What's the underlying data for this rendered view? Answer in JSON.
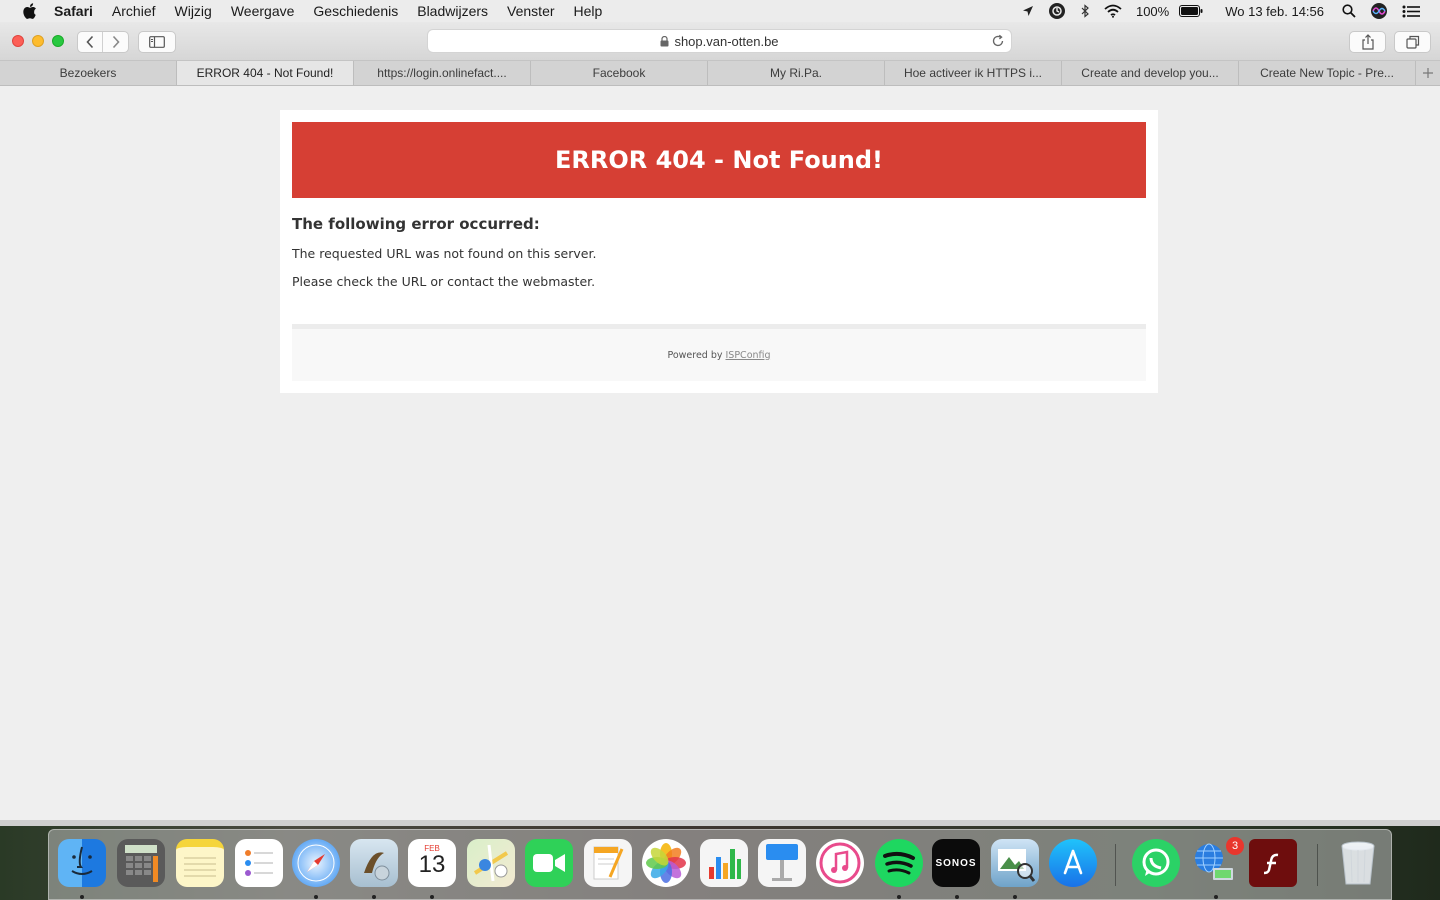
{
  "menubar": {
    "app_name": "Safari",
    "items": [
      "Archief",
      "Wijzig",
      "Weergave",
      "Geschiedenis",
      "Bladwijzers",
      "Venster",
      "Help"
    ],
    "battery": "100%",
    "clock": "Wo 13 feb.  14:56"
  },
  "toolbar": {
    "address": "shop.van-otten.be"
  },
  "tabs": [
    {
      "label": "Bezoekers"
    },
    {
      "label": "ERROR 404 - Not Found!"
    },
    {
      "label": "https://login.onlinefact...."
    },
    {
      "label": "Facebook"
    },
    {
      "label": "My Ri.Pa."
    },
    {
      "label": "Hoe activeer ik HTTPS i..."
    },
    {
      "label": "Create and develop you..."
    },
    {
      "label": "Create New Topic - Pre..."
    }
  ],
  "page": {
    "banner": "ERROR 404 - Not Found!",
    "heading": "The following error occurred:",
    "line1": "The requested URL was not found on this server.",
    "line2": "Please check the URL or contact the webmaster.",
    "footer_prefix": "Powered by",
    "footer_link": "ISPConfig"
  },
  "dock": {
    "apps": [
      "finder-icon",
      "calculator-icon",
      "notes-icon",
      "reminders-icon",
      "safari-icon",
      "mail-icon",
      "calendar-icon",
      "maps-icon",
      "facetime-icon",
      "pages-icon",
      "photos-icon",
      "numbers-icon",
      "keynote-icon",
      "itunes-icon",
      "spotify-icon",
      "sonos-icon",
      "preview-icon",
      "app-store-icon",
      "whatsapp-icon",
      "network-icon",
      "flash-icon",
      "trash-icon"
    ],
    "calendar_month": "FEB",
    "calendar_day": "13",
    "sonos_label": "SONOS",
    "badge_count": "3"
  },
  "colors": {
    "banner": "#d63f34",
    "page_bg": "#efefef"
  }
}
